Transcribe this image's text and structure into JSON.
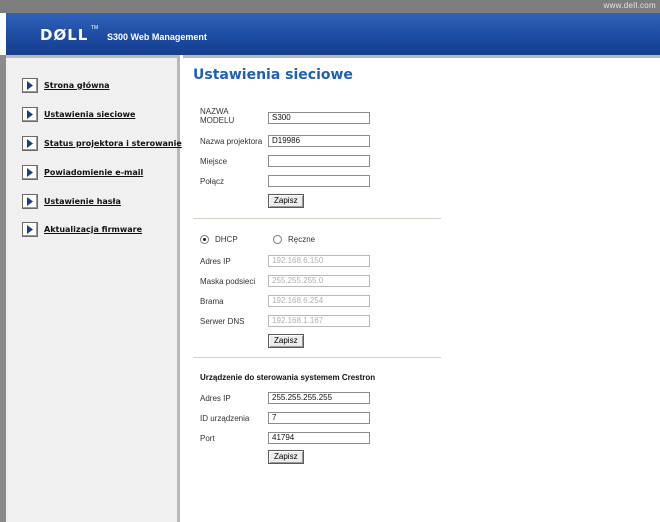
{
  "topbar": {
    "domain": "www.dell.com"
  },
  "header": {
    "logo": "DØLL",
    "trademark": "TM",
    "product": "S300 Web Management"
  },
  "sidebar": {
    "items": [
      {
        "label": "Strona główna",
        "icon": "arrow-right-icon"
      },
      {
        "label": "Ustawienia sieciowe",
        "icon": "arrow-right-icon"
      },
      {
        "label": "Status projektora i sterowanie",
        "icon": "arrow-right-icon"
      },
      {
        "label": "Powiadomienie e-mail",
        "icon": "arrow-right-icon"
      },
      {
        "label": "Ustawienie hasła",
        "icon": "arrow-right-icon"
      },
      {
        "label": "Aktualizacja firmware",
        "icon": "arrow-right-icon"
      }
    ]
  },
  "main": {
    "title": "Ustawienia sieciowe",
    "projector": {
      "model_label_line1": "NAZWA",
      "model_label_line2": "MODELU",
      "model_value": "S300",
      "name_label": "Nazwa projektora",
      "name_value": "D19986",
      "place_label": "Miejsce",
      "place_value": "",
      "contact_label": "Połącz",
      "contact_value": "",
      "save_label": "Zapisz"
    },
    "network": {
      "dhcp_label": "DHCP",
      "manual_label": "Ręczne",
      "selected": "DHCP",
      "ip_label": "Adres IP",
      "ip_value": "192.168.6.150",
      "mask_label": "Maska podsieci",
      "mask_value": "255.255.255.0",
      "gateway_label": "Brama",
      "gateway_value": "192.168.6.254",
      "dns_label": "Serwer DNS",
      "dns_value": "192.168.1.167",
      "save_label": "Zapisz"
    },
    "crestron": {
      "title": "Urządzenie do sterowania systemem Crestron",
      "ip_label": "Adres IP",
      "ip_value": "255.255.255.255",
      "device_id_label": "ID urządzenia",
      "device_id_value": "7",
      "port_label": "Port",
      "port_value": "41794",
      "save_label": "Zapisz"
    }
  },
  "colors": {
    "header_blue": "#1b4aa0",
    "title_blue": "#1f5fb5",
    "frame_gray": "#7d7d7d"
  }
}
